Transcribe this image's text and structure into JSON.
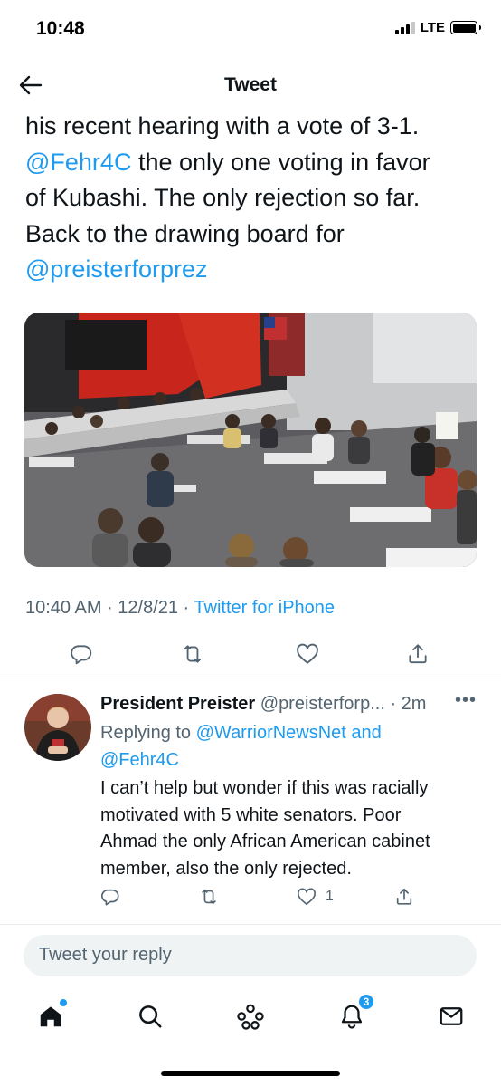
{
  "status_bar": {
    "time": "10:48",
    "network": "LTE"
  },
  "header": {
    "title": "Tweet"
  },
  "tweet": {
    "text_lines": [
      [
        {
          "t": "his recent hearing with a vote of 3-1.",
          "link": false
        }
      ],
      [
        {
          "t": "@Fehr4C",
          "link": true
        },
        {
          "t": " the only one voting in favor",
          "link": false
        }
      ],
      [
        {
          "t": "of Kubashi. The only rejection so far.",
          "link": false
        }
      ],
      [
        {
          "t": "Back to the drawing board for",
          "link": false
        }
      ],
      [
        {
          "t": "@preisterforprez",
          "link": true
        }
      ]
    ],
    "timestamp": "10:40 AM · 12/8/21 · ",
    "source": "Twitter for iPhone"
  },
  "reply": {
    "name": "President Preister",
    "handle": " @preisterforp...",
    "time": " · 2m",
    "more": "•••",
    "replying_prefix": "Replying to ",
    "replying_to_1": "@WarriorNewsNet",
    "replying_and": " and",
    "replying_to_2": "@Fehr4C",
    "body_lines": [
      "I can’t help but wonder if this was racially",
      "motivated with 5 white senators. Poor",
      "Ahmad the only African American cabinet",
      "member, also the only rejected."
    ],
    "like_count": "1"
  },
  "compose": {
    "placeholder": "Tweet your reply"
  },
  "tabs": {
    "notifications_badge": "3"
  },
  "colors": {
    "accent": "#1d9bf0",
    "muted": "#536471",
    "text": "#0f1419"
  },
  "icons": [
    "back-arrow-icon",
    "reply-icon",
    "retweet-icon",
    "like-icon",
    "share-icon",
    "more-icon",
    "home-icon",
    "search-icon",
    "spaces-icon",
    "notifications-icon",
    "messages-icon"
  ]
}
